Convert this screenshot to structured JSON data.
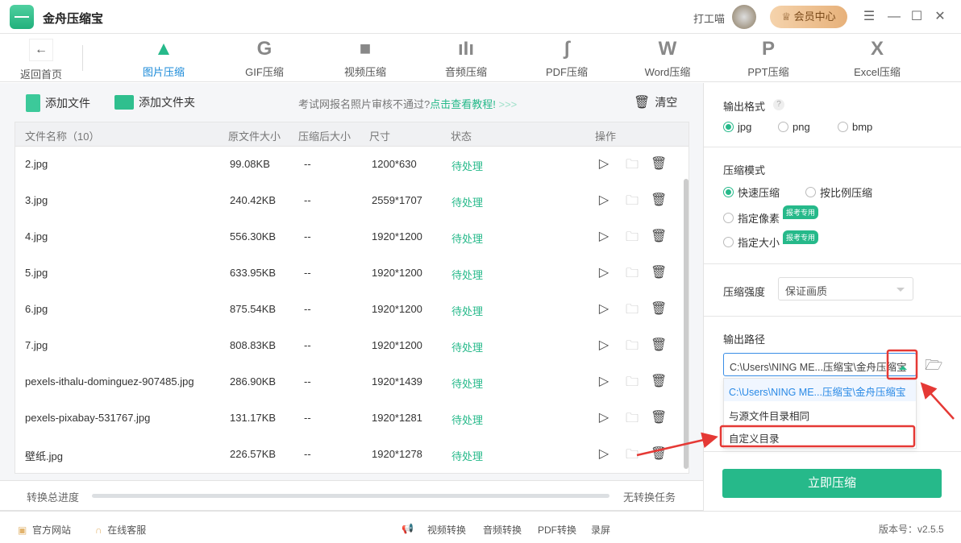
{
  "app": {
    "title": "金舟压缩宝",
    "user": "打工喵",
    "vip": "会员中心"
  },
  "nav": {
    "back": "返回首页",
    "items": [
      {
        "label": "图片压缩",
        "icon": "image-icon",
        "glyph": "▲"
      },
      {
        "label": "GIF压缩",
        "icon": "gif-icon",
        "glyph": "G"
      },
      {
        "label": "视频压缩",
        "icon": "video-icon",
        "glyph": "■"
      },
      {
        "label": "音频压缩",
        "icon": "audio-icon",
        "glyph": "ıIı"
      },
      {
        "label": "PDF压缩",
        "icon": "pdf-icon",
        "glyph": "ʃ"
      },
      {
        "label": "Word压缩",
        "icon": "word-icon",
        "glyph": "W"
      },
      {
        "label": "PPT压缩",
        "icon": "ppt-icon",
        "glyph": "P"
      },
      {
        "label": "Excel压缩",
        "icon": "excel-icon",
        "glyph": "X"
      }
    ]
  },
  "toolbar": {
    "add_file": "添加文件",
    "add_folder": "添加文件夹",
    "tip": "考试网报名照片审核不通过?",
    "tip_link": "点击查看教程!",
    "tip_arrows": ">>>",
    "clear": "清空"
  },
  "table": {
    "headers": [
      "文件名称（10）",
      "原文件大小",
      "压缩后大小",
      "尺寸",
      "状态",
      "操作"
    ],
    "rows": [
      [
        "2.jpg",
        "99.08KB",
        "--",
        "1200*630",
        "待处理"
      ],
      [
        "3.jpg",
        "240.42KB",
        "--",
        "2559*1707",
        "待处理"
      ],
      [
        "4.jpg",
        "556.30KB",
        "--",
        "1920*1200",
        "待处理"
      ],
      [
        "5.jpg",
        "633.95KB",
        "--",
        "1920*1200",
        "待处理"
      ],
      [
        "6.jpg",
        "875.54KB",
        "--",
        "1920*1200",
        "待处理"
      ],
      [
        "7.jpg",
        "808.83KB",
        "--",
        "1920*1200",
        "待处理"
      ],
      [
        "pexels-ithalu-dominguez-907485.jpg",
        "286.90KB",
        "--",
        "1920*1439",
        "待处理"
      ],
      [
        "pexels-pixabay-531767.jpg",
        "131.17KB",
        "--",
        "1920*1281",
        "待处理"
      ],
      [
        "壁纸.jpg",
        "226.57KB",
        "--",
        "1920*1278",
        "待处理"
      ]
    ]
  },
  "progress": {
    "label": "转换总进度",
    "value": 0,
    "status": "无转换任务"
  },
  "footer": {
    "site": "官方网站",
    "service": "在线客服",
    "links": [
      "视频转换",
      "音频转换",
      "PDF转换",
      "录屏"
    ],
    "version": "版本号：v2.5.5"
  },
  "settings": {
    "format_title": "输出格式",
    "help": "?",
    "formats": [
      "jpg",
      "png",
      "bmp"
    ],
    "format_selected": "jpg",
    "mode_title": "压缩模式",
    "modes": [
      "快速压缩",
      "按比例压缩",
      "指定像素",
      "指定大小"
    ],
    "mode_selected": "快速压缩",
    "badge": "报考专用",
    "strength_label": "压缩强度",
    "strength_value": "保证画质",
    "path_title": "输出路径",
    "path_value": "C:\\Users\\NING ME...压缩宝\\金舟压缩宝",
    "path_options": [
      "C:\\Users\\NING ME...压缩宝\\金舟压缩宝",
      "与源文件目录相同",
      "自定义目录"
    ],
    "compress": "立即压缩"
  },
  "colors": {
    "accent": "#26b98a",
    "link": "#1a8ad8",
    "annotation": "#e53935"
  }
}
